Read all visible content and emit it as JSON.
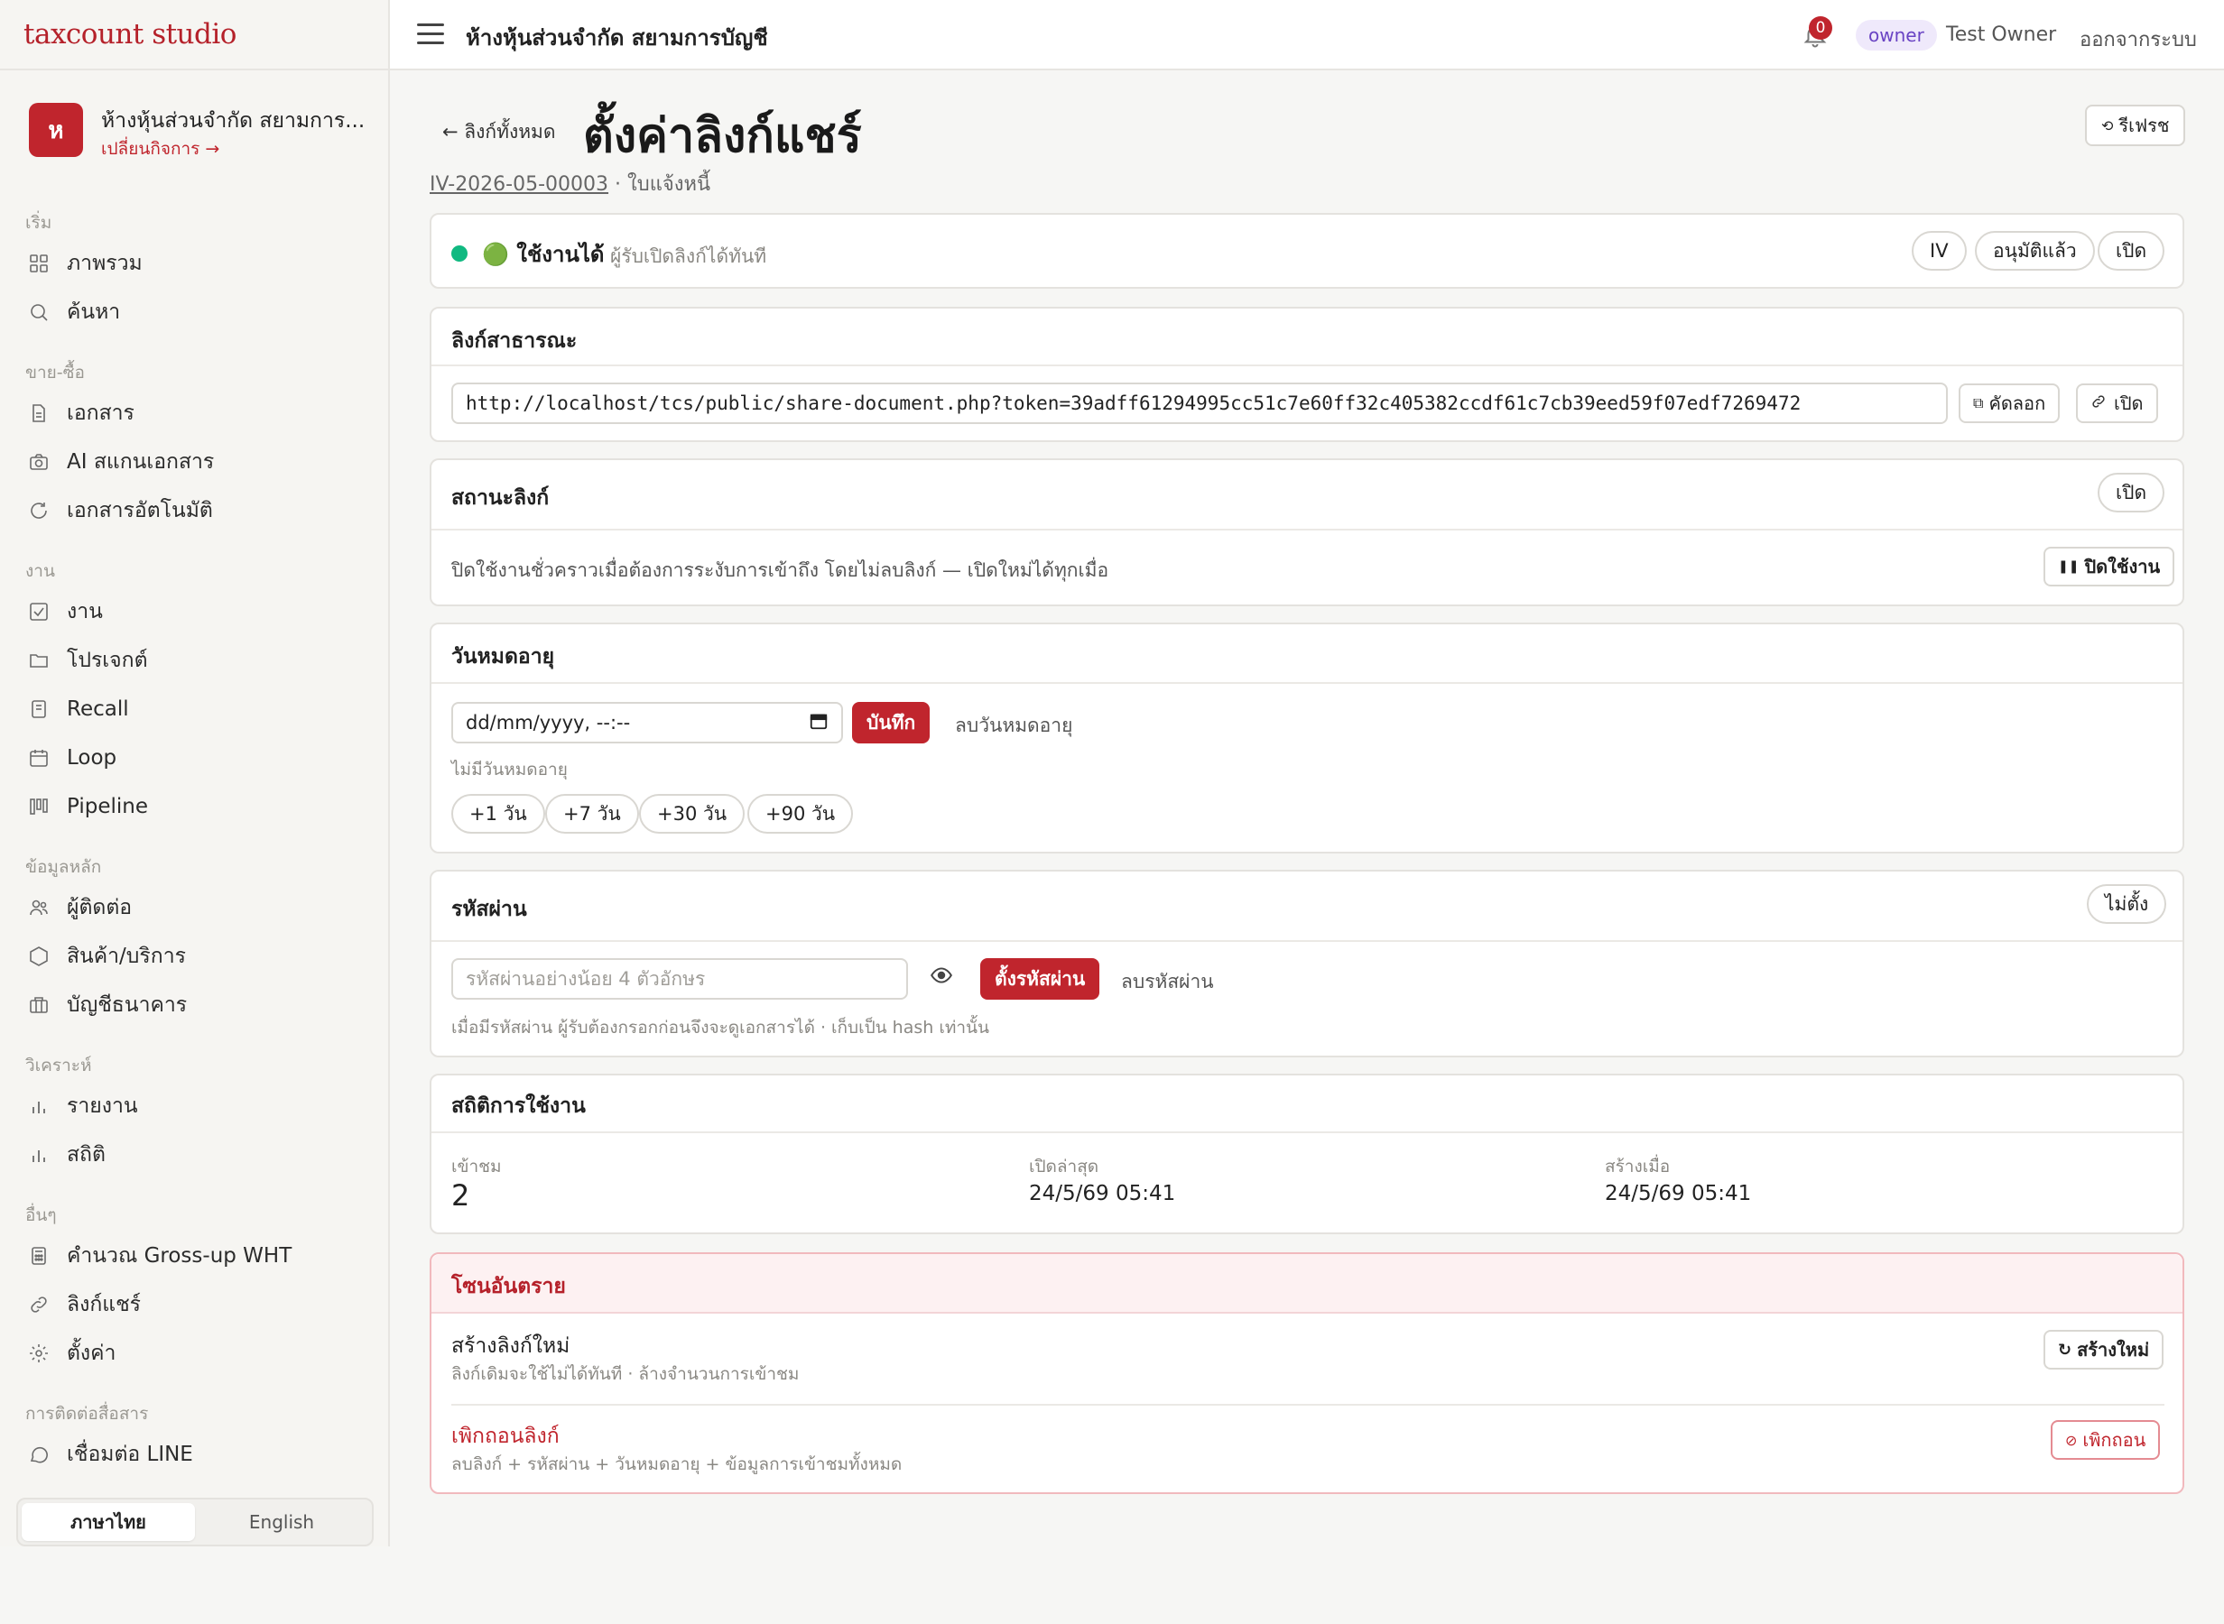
{
  "app": {
    "brand": "taxcount studio"
  },
  "business": {
    "initial": "ห",
    "name": "ห้างหุ้นส่วนจำกัด สยามการ...",
    "switch_label": "เปลี่ยนกิจการ →"
  },
  "topbar": {
    "title": "ห้างหุ้นส่วนจำกัด สยามการบัญชี",
    "notification_count": "0",
    "role": "owner",
    "user_name": "Test Owner",
    "logout": "ออกจากระบบ"
  },
  "sidebar": {
    "sections": [
      {
        "title": "เริ่ม",
        "items": [
          {
            "label": "ภาพรวม",
            "icon": "grid-icon"
          },
          {
            "label": "ค้นหา",
            "icon": "search-icon"
          }
        ]
      },
      {
        "title": "ขาย-ซื้อ",
        "items": [
          {
            "label": "เอกสาร",
            "icon": "document-icon"
          },
          {
            "label": "AI สแกนเอกสาร",
            "icon": "camera-icon"
          },
          {
            "label": "เอกสารอัตโนมัติ",
            "icon": "refresh-icon"
          }
        ]
      },
      {
        "title": "งาน",
        "items": [
          {
            "label": "งาน",
            "icon": "checkbox-icon"
          },
          {
            "label": "โปรเจกต์",
            "icon": "folder-icon"
          },
          {
            "label": "Recall",
            "icon": "clipboard-icon"
          },
          {
            "label": "Loop",
            "icon": "calendar-icon"
          },
          {
            "label": "Pipeline",
            "icon": "kanban-icon"
          }
        ]
      },
      {
        "title": "ข้อมูลหลัก",
        "items": [
          {
            "label": "ผู้ติดต่อ",
            "icon": "users-icon"
          },
          {
            "label": "สินค้า/บริการ",
            "icon": "hexagon-icon"
          },
          {
            "label": "บัญชีธนาคาร",
            "icon": "bank-icon"
          }
        ]
      },
      {
        "title": "วิเคราะห์",
        "items": [
          {
            "label": "รายงาน",
            "icon": "bar-chart-icon"
          },
          {
            "label": "สถิติ",
            "icon": "bar-chart-icon"
          }
        ]
      },
      {
        "title": "อื่นๆ",
        "items": [
          {
            "label": "คำนวณ Gross-up WHT",
            "icon": "calculator-icon"
          },
          {
            "label": "ลิงก์แชร์",
            "icon": "link-icon"
          },
          {
            "label": "ตั้งค่า",
            "icon": "gear-icon"
          }
        ]
      },
      {
        "title": "การติดต่อสื่อสาร",
        "items": [
          {
            "label": "เชื่อมต่อ LINE",
            "icon": "chat-icon"
          }
        ]
      }
    ],
    "lang": {
      "thai": "ภาษาไทย",
      "english": "English"
    }
  },
  "page": {
    "back_label": "← ลิงก์ทั้งหมด",
    "title": "ตั้งค่าลิงก์แชร์",
    "doc_number": "IV-2026-05-00003",
    "doc_type": "· ใบแจ้งหนี้",
    "refresh_label": "รีเฟรช"
  },
  "status_card": {
    "status": "🟢 ใช้งานได้",
    "status_desc": "ผู้รับเปิดลิงก์ได้ทันที",
    "tag_iv": "IV",
    "tag_approved": "อนุมัติแล้ว",
    "open_label": "เปิด",
    "status_color": "#10b981"
  },
  "public_link": {
    "title": "ลิงก์สาธารณะ",
    "url": "http://localhost/tcs/public/share-document.php?token=39adff61294995cc51c7e60ff32c405382ccdf61c7cb39eed59f07edf7269472",
    "copy_label": "คัดลอก",
    "open_label": "เปิด"
  },
  "link_status": {
    "title": "สถานะลิงก์",
    "state_label": "เปิด",
    "desc": "ปิดใช้งานชั่วคราวเมื่อต้องการระงับการเข้าถึง โดยไม่ลบลิงก์ — เปิดใหม่ได้ทุกเมื่อ",
    "disable_label": "ปิดใช้งาน"
  },
  "expiry": {
    "title": "วันหมดอายุ",
    "placeholder": "dd/mm/yyyy, --:--",
    "save_label": "บันทึก",
    "clear_label": "ลบวันหมดอายุ",
    "note": "ไม่มีวันหมดอายุ",
    "presets": [
      "+1 วัน",
      "+7 วัน",
      "+30 วัน",
      "+90 วัน"
    ]
  },
  "password": {
    "title": "รหัสผ่าน",
    "state_label": "ไม่ตั้ง",
    "placeholder": "รหัสผ่านอย่างน้อย 4 ตัวอักษร",
    "set_label": "ตั้งรหัสผ่าน",
    "clear_label": "ลบรหัสผ่าน",
    "note": "เมื่อมีรหัสผ่าน ผู้รับต้องกรอกก่อนจึงจะดูเอกสารได้ · เก็บเป็น hash เท่านั้น"
  },
  "stats": {
    "title": "สถิติการใช้งาน",
    "views_label": "เข้าชม",
    "views": "2",
    "last_open_label": "เปิดล่าสุด",
    "last_open": "24/5/69 05:41",
    "created_label": "สร้างเมื่อ",
    "created": "24/5/69 05:41"
  },
  "danger": {
    "title": "โซนอันตราย",
    "regen_title": "สร้างลิงก์ใหม่",
    "regen_desc": "ลิงก์เดิมจะใช้ไม่ได้ทันที · ล้างจำนวนการเข้าชม",
    "regen_label": "สร้างใหม่",
    "revoke_title": "เพิกถอนลิงก์",
    "revoke_desc": "ลบลิงก์ + รหัสผ่าน + วันหมดอายุ + ข้อมูลการเข้าชมทั้งหมด",
    "revoke_label": "เพิกถอน"
  },
  "colors": {
    "accent": "#c0252d",
    "role_bg": "#efe9fb",
    "role_fg": "#6a44c4"
  }
}
